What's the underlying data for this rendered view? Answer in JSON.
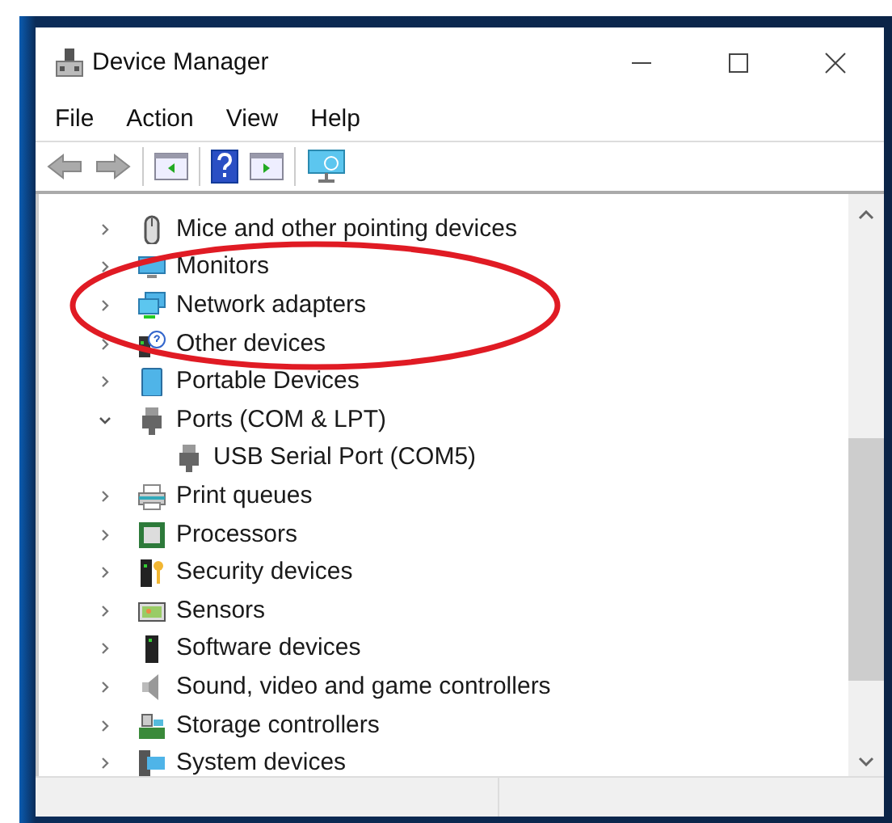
{
  "window": {
    "title": "Device Manager"
  },
  "menu": [
    "File",
    "Action",
    "View",
    "Help"
  ],
  "tree": [
    {
      "label": "Mice and other pointing devices",
      "expanded": false
    },
    {
      "label": "Monitors",
      "expanded": false
    },
    {
      "label": "Network adapters",
      "expanded": false
    },
    {
      "label": "Other devices",
      "expanded": false
    },
    {
      "label": "Portable Devices",
      "expanded": false
    },
    {
      "label": "Ports (COM & LPT)",
      "expanded": true,
      "children": [
        {
          "label": "USB Serial Port (COM5)"
        }
      ]
    },
    {
      "label": "Print queues",
      "expanded": false
    },
    {
      "label": "Processors",
      "expanded": false
    },
    {
      "label": "Security devices",
      "expanded": false
    },
    {
      "label": "Sensors",
      "expanded": false
    },
    {
      "label": "Software devices",
      "expanded": false
    },
    {
      "label": "Sound, video and game controllers",
      "expanded": false
    },
    {
      "label": "Storage controllers",
      "expanded": false
    },
    {
      "label": "System devices",
      "expanded": false
    }
  ],
  "annotations": [
    {
      "kind": "ellipse"
    }
  ]
}
